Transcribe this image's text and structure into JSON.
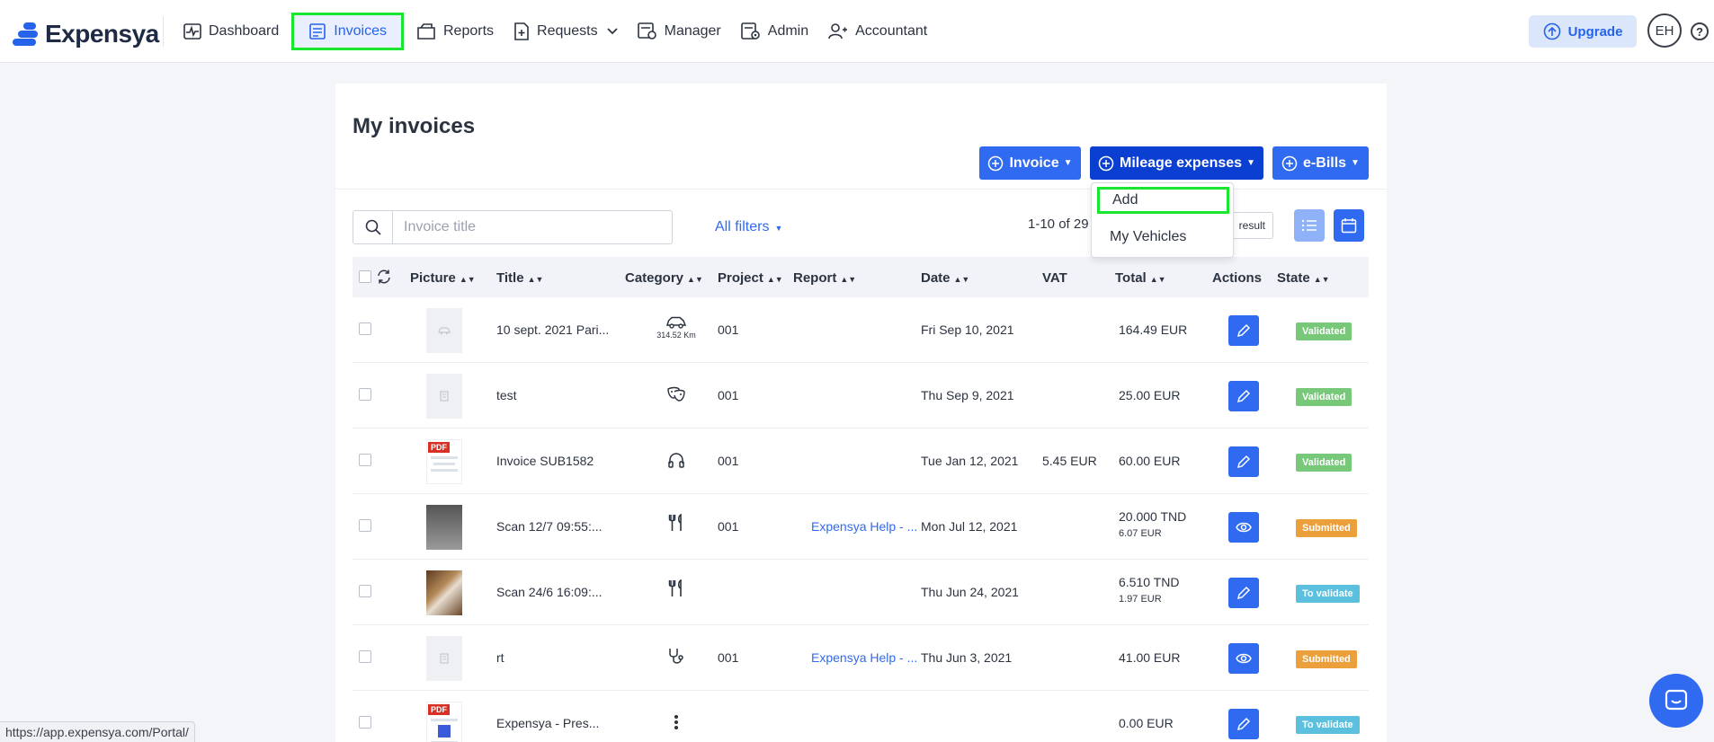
{
  "brand": {
    "name": "Expensya"
  },
  "nav": {
    "items": [
      {
        "key": "dashboard",
        "label": "Dashboard"
      },
      {
        "key": "invoices",
        "label": "Invoices"
      },
      {
        "key": "reports",
        "label": "Reports"
      },
      {
        "key": "requests",
        "label": "Requests"
      },
      {
        "key": "manager",
        "label": "Manager"
      },
      {
        "key": "admin",
        "label": "Admin"
      },
      {
        "key": "accountant",
        "label": "Accountant"
      }
    ],
    "active": "invoices",
    "upgrade_label": "Upgrade",
    "avatar_initials": "EH",
    "help_label": "?"
  },
  "page": {
    "title": "My invoices",
    "buttons": {
      "invoice": "Invoice",
      "mileage": "Mileage expenses",
      "ebills": "e-Bills"
    },
    "dropdown": {
      "add": "Add",
      "vehicles": "My Vehicles"
    },
    "search_placeholder": "Invoice title",
    "filters_label": "All filters",
    "pagination": "1-10 of 29",
    "result_label": "result"
  },
  "table": {
    "headers": {
      "picture": "Picture",
      "title": "Title",
      "category": "Category",
      "project": "Project",
      "report": "Report",
      "date": "Date",
      "vat": "VAT",
      "total": "Total",
      "actions": "Actions",
      "state": "State"
    },
    "rows": [
      {
        "thumb": "car",
        "title": "10 sept. 2021 Pari...",
        "category_icon": "car-icon",
        "category_sub": "314.52 Km",
        "project": "001",
        "report": "",
        "date": "Fri Sep 10, 2021",
        "vat": "",
        "total": "164.49 EUR",
        "total_sub": "",
        "action": "edit",
        "state": "Validated",
        "state_color": "#78c87a"
      },
      {
        "thumb": "doc",
        "title": "test",
        "category_icon": "mask-icon",
        "category_sub": "",
        "project": "001",
        "report": "",
        "date": "Thu Sep 9, 2021",
        "vat": "",
        "total": "25.00 EUR",
        "total_sub": "",
        "action": "edit",
        "state": "Validated",
        "state_color": "#78c87a"
      },
      {
        "thumb": "pdf",
        "title": "Invoice SUB1582",
        "category_icon": "headphones-icon",
        "category_sub": "",
        "project": "001",
        "report": "",
        "date": "Tue Jan 12, 2021",
        "vat": "5.45 EUR",
        "total": "60.00 EUR",
        "total_sub": "",
        "action": "edit",
        "state": "Validated",
        "state_color": "#78c87a"
      },
      {
        "thumb": "dark",
        "title": "Scan 12/7 09:55:...",
        "category_icon": "cutlery-icon",
        "category_sub": "",
        "project": "001",
        "report": "Expensya Help - ...",
        "date": "Mon Jul 12, 2021",
        "vat": "",
        "total": "20.000 TND",
        "total_sub": "6.07 EUR",
        "action": "view",
        "state": "Submitted",
        "state_color": "#eba03c"
      },
      {
        "thumb": "photo",
        "title": "Scan 24/6 16:09:...",
        "category_icon": "cutlery-icon",
        "category_sub": "",
        "project": "",
        "report": "",
        "date": "Thu Jun 24, 2021",
        "vat": "",
        "total": "6.510 TND",
        "total_sub": "1.97 EUR",
        "action": "edit",
        "state": "To validate",
        "state_color": "#5bc0de"
      },
      {
        "thumb": "doc",
        "title": "rt",
        "category_icon": "stethoscope-icon",
        "category_sub": "",
        "project": "001",
        "report": "Expensya Help - ...",
        "date": "Thu Jun 3, 2021",
        "vat": "",
        "total": "41.00 EUR",
        "total_sub": "",
        "action": "view",
        "state": "Submitted",
        "state_color": "#eba03c"
      },
      {
        "thumb": "pdf2",
        "title": "Expensya - Pres...",
        "category_icon": "more-vertical-icon",
        "category_sub": "",
        "project": "",
        "report": "",
        "date": "",
        "vat": "",
        "total": "0.00 EUR",
        "total_sub": "",
        "action": "edit",
        "state": "To validate",
        "state_color": "#5bc0de"
      }
    ]
  },
  "statusbar": {
    "url": "https://app.expensya.com/Portal/"
  },
  "colors": {
    "primary": "#2f6af0",
    "primary_dark": "#0b3fd1",
    "highlight": "#19e62e"
  }
}
